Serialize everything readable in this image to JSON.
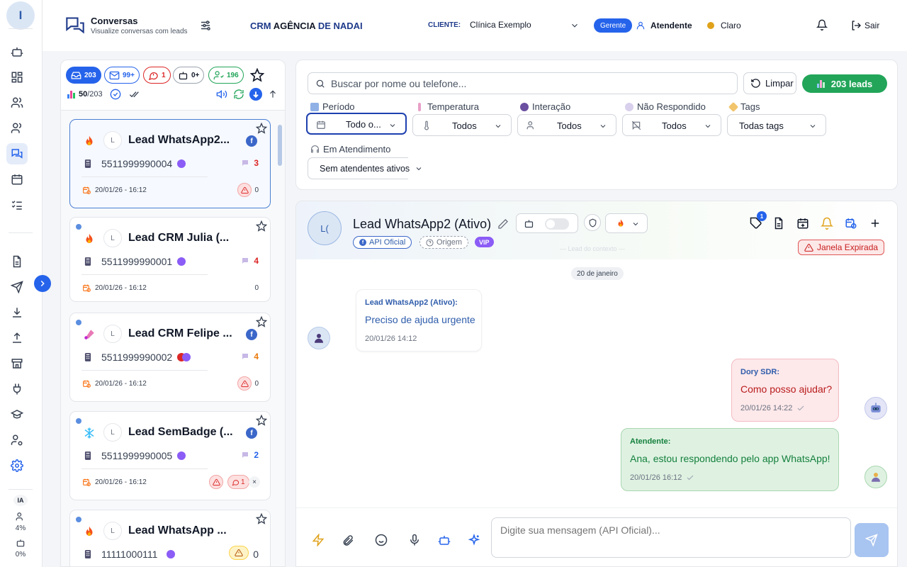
{
  "rail": {
    "avatar_initial": "I",
    "ai_label": "IA",
    "stat1": "4%",
    "stat2": "0%"
  },
  "header": {
    "title": "Conversas",
    "subtitle": "Visualize conversas com leads",
    "brand_prefix": "CRM ",
    "brand_main": "AGÊNCIA",
    "brand_suffix": " DE NADAI",
    "client_label": "CLIENTE:",
    "client_value": "Clínica Exemplo",
    "role_badge": "Gerente",
    "user_name": "Atendente",
    "theme": "Claro",
    "logout": "Sair"
  },
  "chips": {
    "inbox": "203",
    "mail": "99+",
    "unanswered": "1",
    "bot": "0+",
    "users": "196"
  },
  "counter": {
    "shown": "50",
    "total": "/203"
  },
  "leads": [
    {
      "name": "Lead WhatsApp2...",
      "initial": "L",
      "phone": "5511999990004",
      "count": "3",
      "count_color": "#dc2626",
      "date": "20/01/26 - 16:12",
      "alerts": "0",
      "temp": "fire",
      "fb": true,
      "dots": 1
    },
    {
      "name": "Lead CRM Julia (...",
      "initial": "L",
      "phone": "5511999990001",
      "count": "4",
      "count_color": "#dc2626",
      "date": "20/01/26 - 16:12",
      "alerts": "0",
      "temp": "fire",
      "fb": false,
      "dots": 1
    },
    {
      "name": "Lead CRM Felipe ...",
      "initial": "L",
      "phone": "5511999990002",
      "count": "4",
      "count_color": "#ea7a0c",
      "date": "20/01/26 - 16:12",
      "alerts": "0",
      "temp": "thermo",
      "fb": true,
      "dots": 2
    },
    {
      "name": "Lead SemBadge (...",
      "initial": "L",
      "phone": "5511999990005",
      "count": "2",
      "count_color": "#2563eb",
      "date": "20/01/26 - 16:12",
      "alerts": "1",
      "temp": "snow",
      "fb": true,
      "dots": 1
    },
    {
      "name": "Lead WhatsApp ...",
      "initial": "L",
      "phone": "11111000111",
      "count": "0",
      "count_color": "#374151",
      "date": "",
      "alerts": "",
      "temp": "fire",
      "fb": false,
      "dots": 1
    }
  ],
  "search": {
    "placeholder": "Buscar por nome ou telefone..."
  },
  "actions": {
    "clear": "Limpar",
    "leads": "203 leads"
  },
  "filters": {
    "period_label": "Período",
    "period_value": "Todo o...",
    "temp_label": "Temperatura",
    "temp_value": "Todos",
    "interaction_label": "Interação",
    "interaction_value": "Todos",
    "unanswered_label": "Não Respondido",
    "unanswered_value": "Todos",
    "tags_label": "Tags",
    "tags_value": "Todas tags",
    "attending_label": "Em Atendimento",
    "attending_value": "Sem atendentes ativos"
  },
  "chat": {
    "avatar": "L(",
    "name": "Lead WhatsApp2 (Ativo)",
    "badge_api": "API Oficial",
    "badge_origin": "Origem",
    "badge_vip": "VIP",
    "faint": "— Lead do contexto —",
    "tag_count": "1",
    "expired": "Janela Expirada",
    "date_sep": "20 de janeiro"
  },
  "messages": [
    {
      "author": "Lead WhatsApp2 (Ativo):",
      "text": "Preciso de ajuda urgente",
      "time": "20/01/26 14:12"
    },
    {
      "author": "Dory SDR:",
      "text": "Como posso ajudar?",
      "time": "20/01/26 14:22"
    },
    {
      "author": "Atendente:",
      "text": "Ana, estou respondendo pelo app WhatsApp!",
      "time": "20/01/26 16:12"
    }
  ],
  "composer": {
    "placeholder": "Digite sua mensagem (API Oficial)..."
  },
  "colors": {
    "accent": "#2563eb",
    "success": "#22a559",
    "danger": "#dc2626",
    "brand": "#1e3a8a"
  }
}
